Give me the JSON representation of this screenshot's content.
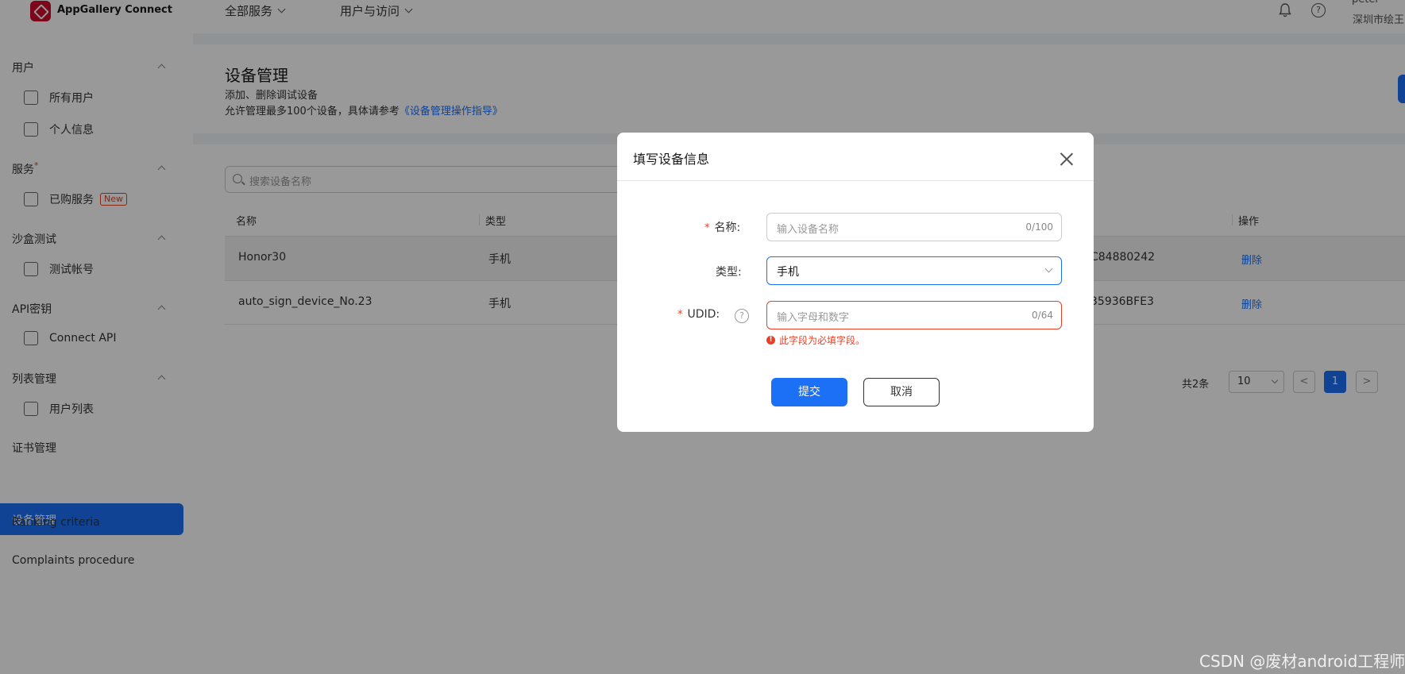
{
  "brand": {
    "name": "AppGallery Connect"
  },
  "topnav": {
    "all_services": "全部服务",
    "users_access": "用户与访问"
  },
  "user": {
    "name": "peter",
    "company": "深圳市绘王"
  },
  "sidebar": {
    "group_user": "用户",
    "item_all_users": "所有用户",
    "item_profile": "个人信息",
    "group_service": "服务",
    "red_mark": "*",
    "item_purchased": "已购服务",
    "badge_new": "New",
    "group_sandbox": "沙盒测试",
    "item_test_account": "测试帐号",
    "group_api": "API密钥",
    "item_connect_api": "Connect API",
    "group_list": "列表管理",
    "item_user_list": "用户列表",
    "item_cert": "证书管理",
    "item_device": "设备管理",
    "item_ranking": "Ranking criteria",
    "item_complaints": "Complaints procedure"
  },
  "page": {
    "title": "设备管理",
    "desc1": "添加、删除调试设备",
    "desc2_prefix": "允许管理最多100个设备，具体请参考",
    "desc2_link": "《设备管理操作指导》"
  },
  "search": {
    "placeholder": "搜索设备名称"
  },
  "table": {
    "headers": {
      "name": "名称",
      "type": "类型",
      "action": "操作"
    },
    "rows": [
      {
        "name": "Honor30",
        "type": "手机",
        "udid": "C84880242",
        "action": "删除"
      },
      {
        "name": "auto_sign_device_No.23",
        "type": "手机",
        "udid": "35936BFE3",
        "action": "删除"
      }
    ]
  },
  "pagination": {
    "total": "共2条",
    "page_size": "10",
    "current": "1",
    "prev": "<",
    "next": ">"
  },
  "dialog": {
    "title": "填写设备信息",
    "required_mark": "*",
    "name_label": "名称:",
    "name_placeholder": "输入设备名称",
    "name_count": "0/100",
    "type_label": "类型:",
    "type_value": "手机",
    "udid_label": "UDID:",
    "udid_help": "?",
    "udid_placeholder": "输入字母和数字",
    "udid_count": "0/64",
    "error_icon": "!",
    "error_msg": "此字段为必填字段。",
    "submit": "提交",
    "cancel": "取消"
  },
  "watermark": "CSDN @废材android工程师",
  "colors": {
    "primary": "#1b70f5",
    "error": "#e84026",
    "brand": "#cf0a2c"
  }
}
